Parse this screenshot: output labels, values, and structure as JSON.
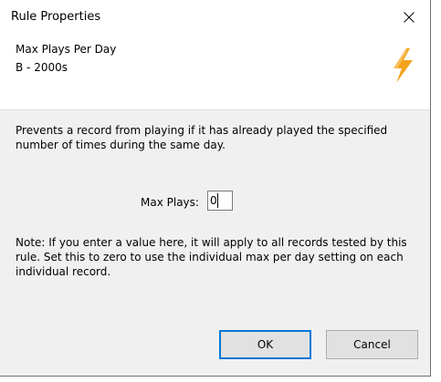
{
  "window": {
    "title": "Rule Properties"
  },
  "header": {
    "rule_name": "Max Plays Per Day",
    "category": "B - 2000s",
    "icon": "lightning-bolt-icon",
    "icon_color": "#f4a21c"
  },
  "body": {
    "description": "Prevents a record from playing if it has already played the specified number of times during the same day.",
    "max_plays_label": "Max Plays:",
    "max_plays_value": "0",
    "note": "Note: If you enter a value here, it will apply to all records tested by this rule. Set this to zero to use the individual max per day setting on each individual record."
  },
  "buttons": {
    "ok_label": "OK",
    "cancel_label": "Cancel"
  },
  "colors": {
    "panel_background": "#f0f0f0",
    "focus_border": "#0078d7"
  }
}
